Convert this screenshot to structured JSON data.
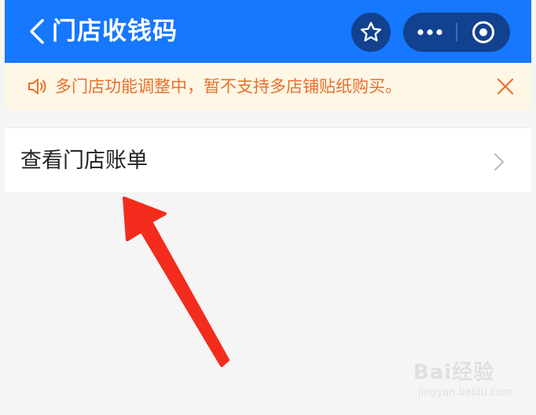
{
  "header": {
    "title": "门店收钱码",
    "bg_color": "#1677ff",
    "capsule_color": "#12418f",
    "icons": [
      "chevron-left-icon",
      "star-icon",
      "more-dots-icon",
      "target-circle-icon"
    ]
  },
  "notice": {
    "text": "多门店功能调整中，暂不支持多店铺贴纸购买。",
    "bg_color": "#fff7e6",
    "text_color": "#e8702a",
    "icons": [
      "speaker-icon",
      "close-icon"
    ]
  },
  "menu": {
    "items": [
      {
        "label": "查看门店账单",
        "icon": "chevron-right-icon"
      }
    ]
  },
  "annotation": {
    "type": "arrow",
    "color": "#f42c1d"
  },
  "watermark": {
    "logo_text": "Bai经验",
    "url": "jingyan.baidu.com"
  }
}
